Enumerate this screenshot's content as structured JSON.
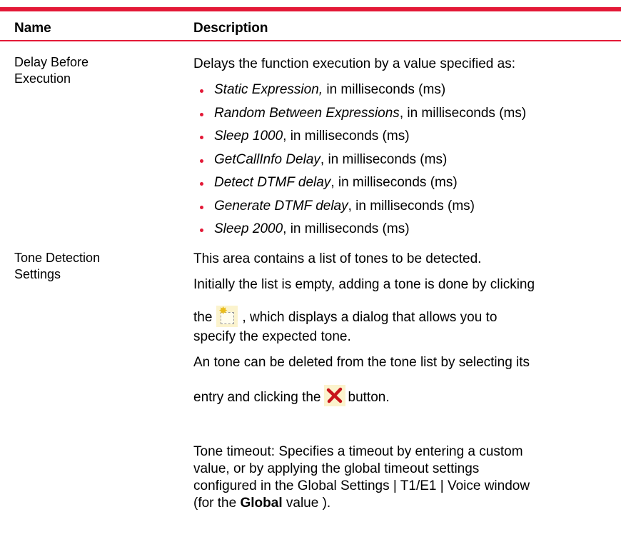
{
  "table": {
    "headers": {
      "name": "Name",
      "description": "Description"
    },
    "rows": [
      {
        "name_lines": [
          "Delay Before",
          "Execution"
        ],
        "intro": "Delays the function execution by a value specified as:",
        "options": [
          {
            "term": "Static Expression,",
            "rest": " in milliseconds (ms)"
          },
          {
            "term": "Random Between Expressions",
            "rest": ", in milliseconds (ms)"
          },
          {
            "term": "Sleep 1000",
            "rest": ", in milliseconds (ms)"
          },
          {
            "term": "GetCallInfo Delay",
            "rest": ", in milliseconds (ms)"
          },
          {
            "term": "Detect DTMF delay",
            "rest": ", in milliseconds (ms)"
          },
          {
            "term": "Generate DTMF delay",
            "rest": ", in milliseconds (ms)"
          },
          {
            "term": "Sleep 2000",
            "rest": ", in milliseconds (ms)"
          }
        ]
      },
      {
        "name_lines": [
          "Tone Detection",
          "Settings"
        ],
        "p1": "This area contains a list of tones to be detected.",
        "p2": "Initially the list is empty, adding a tone is done by clicking",
        "p3a": "the",
        "p3b": ", which displays a dialog that allows you to",
        "p4": "specify the expected tone.",
        "p5": "An tone can be deleted from the tone list by selecting its",
        "p6a": "entry and clicking the",
        "p6b": "button.",
        "timeout_lines": [
          "Tone timeout: Specifies a timeout by entering a custom",
          "value, or by applying the global timeout settings",
          "configured in the Global Settings | T1/E1 | Voice window"
        ],
        "last_a": "(for the",
        "last_bold": "Global",
        "last_b": " value )."
      }
    ]
  },
  "icons": {
    "add": "add-tone-icon",
    "delete": "delete-tone-icon"
  },
  "colors": {
    "accent": "#e31937",
    "delete_x": "#c8151b",
    "icon_bg": "#fbf3cd"
  }
}
